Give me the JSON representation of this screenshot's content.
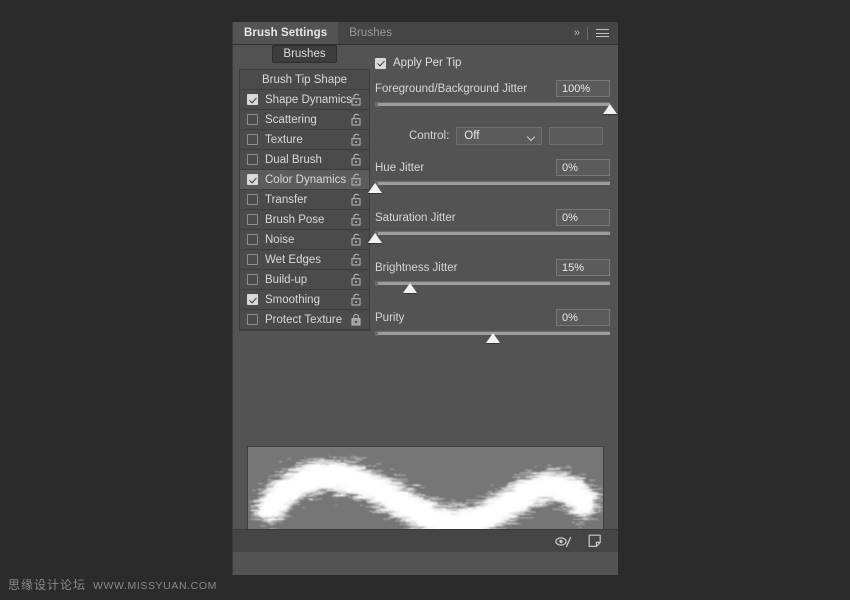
{
  "window": {
    "panel_title": "Brush Settings"
  },
  "tabs": [
    {
      "label": "Brush Settings",
      "active": true
    },
    {
      "label": "Brushes",
      "active": false
    }
  ],
  "header_controls": {
    "collapse_icon": "chevron-double-right-icon",
    "menu_icon": "hamburger-menu-icon"
  },
  "sidebar": {
    "brushes_button": "Brushes",
    "tip_shape": "Brush Tip Shape",
    "items": [
      {
        "label": "Shape Dynamics",
        "checked": true,
        "selected": false,
        "locked": false
      },
      {
        "label": "Scattering",
        "checked": false,
        "selected": false,
        "locked": false
      },
      {
        "label": "Texture",
        "checked": false,
        "selected": false,
        "locked": false
      },
      {
        "label": "Dual Brush",
        "checked": false,
        "selected": false,
        "locked": false
      },
      {
        "label": "Color Dynamics",
        "checked": true,
        "selected": true,
        "locked": false
      },
      {
        "label": "Transfer",
        "checked": false,
        "selected": false,
        "locked": false
      },
      {
        "label": "Brush Pose",
        "checked": false,
        "selected": false,
        "locked": false
      },
      {
        "label": "Noise",
        "checked": false,
        "selected": false,
        "locked": false
      },
      {
        "label": "Wet Edges",
        "checked": false,
        "selected": false,
        "locked": false
      },
      {
        "label": "Build-up",
        "checked": false,
        "selected": false,
        "locked": false
      },
      {
        "label": "Smoothing",
        "checked": true,
        "selected": false,
        "locked": false
      },
      {
        "label": "Protect Texture",
        "checked": false,
        "selected": false,
        "locked": true
      }
    ]
  },
  "options": {
    "apply_per_tip": {
      "label": "Apply Per Tip",
      "checked": true
    },
    "fg_bg_jitter": {
      "label": "Foreground/Background Jitter",
      "value": "100%",
      "percent": 100
    },
    "control": {
      "label": "Control:",
      "value": "Off",
      "extra_value": ""
    },
    "hue_jitter": {
      "label": "Hue Jitter",
      "value": "0%",
      "percent": 0
    },
    "saturation_jitter": {
      "label": "Saturation Jitter",
      "value": "0%",
      "percent": 0
    },
    "brightness_jitter": {
      "label": "Brightness Jitter",
      "value": "15%",
      "percent": 15
    },
    "purity": {
      "label": "Purity",
      "value": "0%",
      "percent": 50
    }
  },
  "footer": {
    "toggle_brush_preview_icon": "eye-brush-preview-icon",
    "new_brush_icon": "new-brush-preset-icon"
  },
  "watermark": {
    "chinese": "思缘设计论坛",
    "url": "WWW.MISSYUAN.COM"
  },
  "colors": {
    "panel_bg": "#535353",
    "tab_bg": "#454545",
    "list_bg": "#4b4b4b",
    "selected_row": "#5c5c5c",
    "preview_bg": "#767676",
    "desktop_bg": "#2b2b2b",
    "text": "#d8d8d8",
    "slider_track": "#9c9c9c",
    "slider_thumb": "#f2f2f2"
  }
}
